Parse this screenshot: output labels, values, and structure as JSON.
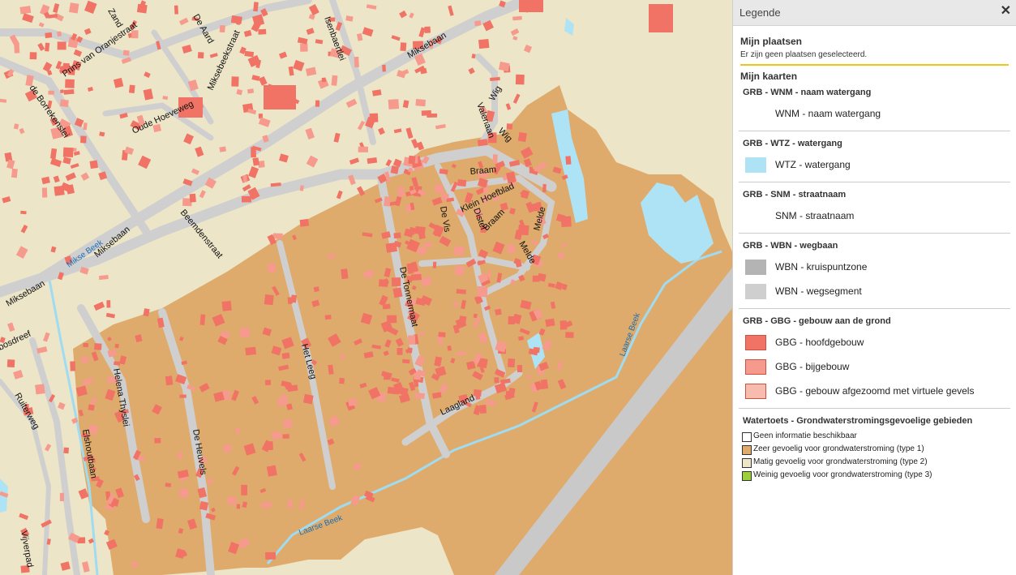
{
  "legend": {
    "title": "Legende",
    "close_icon": "close-icon",
    "mijn_plaatsen": {
      "title": "Mijn plaatsen",
      "note": "Er zijn geen plaatsen geselecteerd."
    },
    "mijn_kaarten": {
      "title": "Mijn kaarten",
      "groups": [
        {
          "title": "GRB - WNM - naam watergang",
          "items": [
            {
              "label": "WNM - naam watergang",
              "color": ""
            }
          ]
        },
        {
          "title": "GRB - WTZ - watergang",
          "items": [
            {
              "label": "WTZ - watergang",
              "color": "#aee3f5"
            }
          ]
        },
        {
          "title": "GRB - SNM - straatnaam",
          "items": [
            {
              "label": "SNM - straatnaam",
              "color": ""
            }
          ]
        },
        {
          "title": "GRB - WBN - wegbaan",
          "items": [
            {
              "label": "WBN - kruispuntzone",
              "color": "#b4b4b4"
            },
            {
              "label": "WBN - wegsegment",
              "color": "#cfcfcf"
            }
          ]
        },
        {
          "title": "GRB - GBG - gebouw aan de grond",
          "items": [
            {
              "label": "GBG - hoofdgebouw",
              "color": "#f07365"
            },
            {
              "label": "GBG - bijgebouw",
              "color": "#f59a8c"
            },
            {
              "label": "GBG - gebouw afgezoomd met virtuele gevels",
              "color": "#f8bcaf"
            }
          ]
        }
      ],
      "watertoets": {
        "title": "Watertoets - Grondwaterstromingsgevoelige gebieden",
        "items": [
          {
            "label": "Geen informatie beschikbaar",
            "color": "#ffffff"
          },
          {
            "label": "Zeer gevoelig voor grondwaterstroming (type 1)",
            "color": "#dfab6c"
          },
          {
            "label": "Matig gevoelig voor grondwaterstroming (type 2)",
            "color": "#ece5c8"
          },
          {
            "label": "Weinig gevoelig voor grondwaterstroming (type 3)",
            "color": "#9ccf3c"
          }
        ]
      }
    }
  },
  "map": {
    "street_labels": [
      "Zand",
      "Prins van Oranjestraat",
      "De Aard",
      "Miksebeekstraat",
      "Isenbaertlei",
      "Miksebaan",
      "de Borrekenslei",
      "Oude Hoeveweg",
      "Valeriaan",
      "Wig",
      "Braam",
      "Klein Hoefblad",
      "De Vis",
      "Distel",
      "Melde",
      "Beemdenstraat",
      "Miksebaan",
      "Miksebaan",
      "De Tonnermaat",
      "Het Leeg",
      "Helena Thyslei",
      "De Heuvels",
      "Ruiterweg",
      "Elshoutbaan",
      "Laagland",
      "Vijverpad",
      "bosdreef"
    ],
    "water_labels": [
      "Mikse Beek",
      "Laarse Beek",
      "Laarse Beek"
    ]
  }
}
